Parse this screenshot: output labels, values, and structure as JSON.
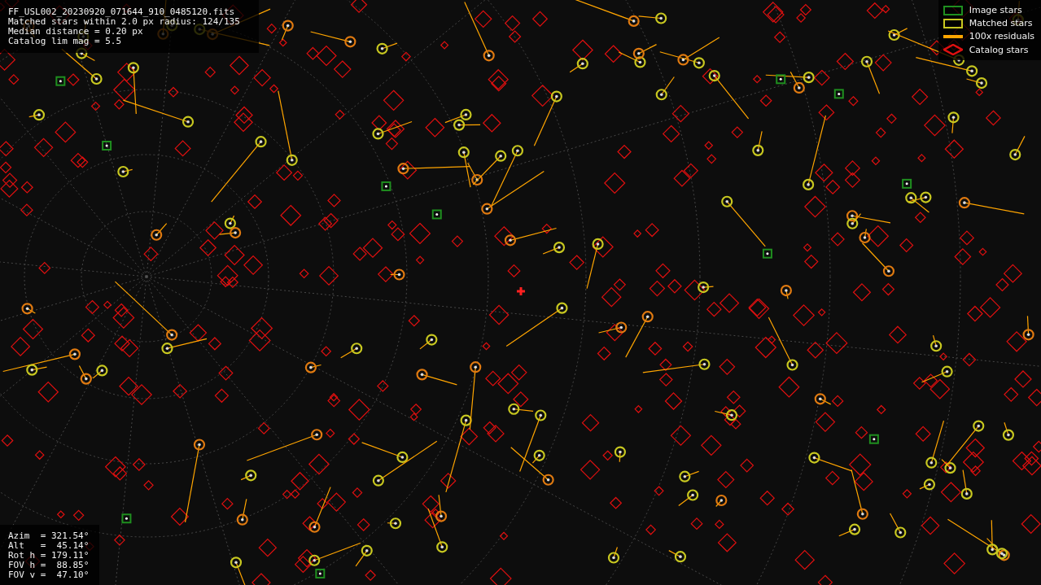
{
  "info_panel": {
    "lines": [
      "FF_USL002_20230920_071644_910_0485120.fits",
      "Matched stars within 2.0 px radius: 124/135",
      "Median distance = 0.20 px",
      "Catalog lim mag = 5.5"
    ]
  },
  "legend": [
    {
      "kind": "image",
      "label": "Image stars",
      "color": "#1f8f1f"
    },
    {
      "kind": "matched",
      "label": "Matched stars",
      "color": "#c8c820"
    },
    {
      "kind": "residual",
      "label": "100x residuals",
      "color": "#ffa500"
    },
    {
      "kind": "catalog",
      "label": "Catalog stars",
      "color": "#e01010"
    }
  ],
  "pointing_panel": {
    "lines": [
      "Azim  = 321.54°",
      "Alt   =  45.14°",
      "Rot h = 179.11°",
      "FOV h =  88.85°",
      "FOV v =  47.10°"
    ]
  }
}
